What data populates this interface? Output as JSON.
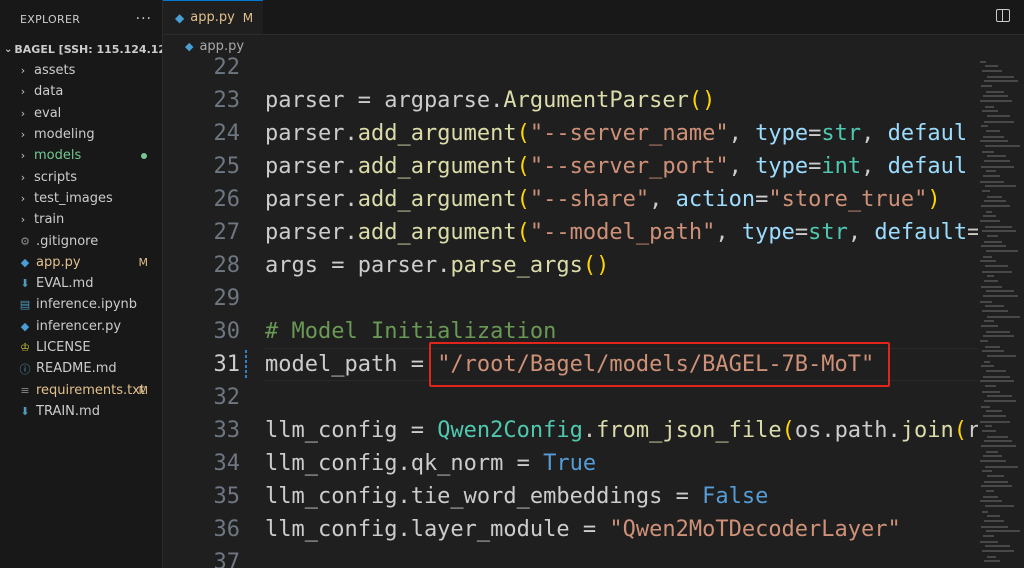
{
  "sidebar": {
    "title": "EXPLORER",
    "more": "···",
    "workspace": "BAGEL [SSH: 115.124.12...",
    "items": [
      {
        "label": "assets",
        "type": "folder"
      },
      {
        "label": "data",
        "type": "folder"
      },
      {
        "label": "eval",
        "type": "folder"
      },
      {
        "label": "modeling",
        "type": "folder"
      },
      {
        "label": "models",
        "type": "folder",
        "status": "dot",
        "color": "#73c991"
      },
      {
        "label": "scripts",
        "type": "folder"
      },
      {
        "label": "test_images",
        "type": "folder"
      },
      {
        "label": "train",
        "type": "folder"
      },
      {
        "label": ".gitignore",
        "type": "file",
        "icon": "gear-icon"
      },
      {
        "label": "app.py",
        "type": "file",
        "icon": "python-icon",
        "badge": "M",
        "color": "#e2c08d"
      },
      {
        "label": "EVAL.md",
        "type": "file",
        "icon": "markdown-icon"
      },
      {
        "label": "inference.ipynb",
        "type": "file",
        "icon": "notebook-icon"
      },
      {
        "label": "inferencer.py",
        "type": "file",
        "icon": "python-icon"
      },
      {
        "label": "LICENSE",
        "type": "file",
        "icon": "license-icon"
      },
      {
        "label": "README.md",
        "type": "file",
        "icon": "info-icon"
      },
      {
        "label": "requirements.txt",
        "type": "file",
        "icon": "text-icon",
        "badge": "M",
        "color": "#e2c08d"
      },
      {
        "label": "TRAIN.md",
        "type": "file",
        "icon": "markdown-icon"
      }
    ]
  },
  "editor": {
    "tab": {
      "label": "app.py",
      "modified": "M",
      "close": "×"
    },
    "breadcrumb": "app.py"
  },
  "code": {
    "lines": [
      {
        "n": "22",
        "tokens": []
      },
      {
        "n": "23",
        "tokens": [
          [
            "",
            "parser = argparse."
          ],
          [
            "fn",
            "ArgumentParser"
          ],
          [
            "br1",
            "()"
          ]
        ]
      },
      {
        "n": "24",
        "tokens": [
          [
            "",
            "parser."
          ],
          [
            "fn",
            "add_argument"
          ],
          [
            "br1",
            "("
          ],
          [
            "str",
            "\"--server_name\""
          ],
          [
            "",
            ", "
          ],
          [
            "kw",
            "type"
          ],
          [
            "",
            "="
          ],
          [
            "cls",
            "str"
          ],
          [
            "",
            ", "
          ],
          [
            "kw",
            "defaul"
          ]
        ]
      },
      {
        "n": "25",
        "tokens": [
          [
            "",
            "parser."
          ],
          [
            "fn",
            "add_argument"
          ],
          [
            "br1",
            "("
          ],
          [
            "str",
            "\"--server_port\""
          ],
          [
            "",
            ", "
          ],
          [
            "kw",
            "type"
          ],
          [
            "",
            "="
          ],
          [
            "cls",
            "int"
          ],
          [
            "",
            ", "
          ],
          [
            "kw",
            "defaul"
          ]
        ]
      },
      {
        "n": "26",
        "tokens": [
          [
            "",
            "parser."
          ],
          [
            "fn",
            "add_argument"
          ],
          [
            "br1",
            "("
          ],
          [
            "str",
            "\"--share\""
          ],
          [
            "",
            ", "
          ],
          [
            "kw",
            "action"
          ],
          [
            "",
            "="
          ],
          [
            "str",
            "\"store_true\""
          ],
          [
            "br1",
            ")"
          ]
        ]
      },
      {
        "n": "27",
        "tokens": [
          [
            "",
            "parser."
          ],
          [
            "fn",
            "add_argument"
          ],
          [
            "br1",
            "("
          ],
          [
            "str",
            "\"--model_path\""
          ],
          [
            "",
            ", "
          ],
          [
            "kw",
            "type"
          ],
          [
            "",
            "="
          ],
          [
            "cls",
            "str"
          ],
          [
            "",
            ", "
          ],
          [
            "kw",
            "default"
          ],
          [
            "",
            "="
          ]
        ]
      },
      {
        "n": "28",
        "tokens": [
          [
            "",
            "args = parser."
          ],
          [
            "fn",
            "parse_args"
          ],
          [
            "br1",
            "()"
          ]
        ]
      },
      {
        "n": "29",
        "tokens": []
      },
      {
        "n": "30",
        "tokens": [
          [
            "cmt",
            "# Model Initialization"
          ]
        ]
      },
      {
        "n": "31",
        "tokens": [
          [
            "",
            "model_path = "
          ],
          [
            "str",
            "\"/root/Bagel/models/BAGEL-7B-MoT\""
          ]
        ],
        "current": true
      },
      {
        "n": "32",
        "tokens": []
      },
      {
        "n": "33",
        "tokens": [
          [
            "",
            "llm_config = "
          ],
          [
            "cls",
            "Qwen2Config"
          ],
          [
            "",
            "."
          ],
          [
            "fn",
            "from_json_file"
          ],
          [
            "br1",
            "("
          ],
          [
            "",
            "os.path."
          ],
          [
            "fn",
            "join"
          ],
          [
            "br1",
            "("
          ],
          [
            "",
            "r"
          ]
        ]
      },
      {
        "n": "34",
        "tokens": [
          [
            "",
            "llm_config.qk_norm = "
          ],
          [
            "bool",
            "True"
          ]
        ]
      },
      {
        "n": "35",
        "tokens": [
          [
            "",
            "llm_config.tie_word_embeddings = "
          ],
          [
            "bool",
            "False"
          ]
        ]
      },
      {
        "n": "36",
        "tokens": [
          [
            "",
            "llm_config.layer_module = "
          ],
          [
            "str",
            "\"Qwen2MoTDecoderLayer\""
          ]
        ]
      },
      {
        "n": "37",
        "tokens": []
      }
    ]
  }
}
